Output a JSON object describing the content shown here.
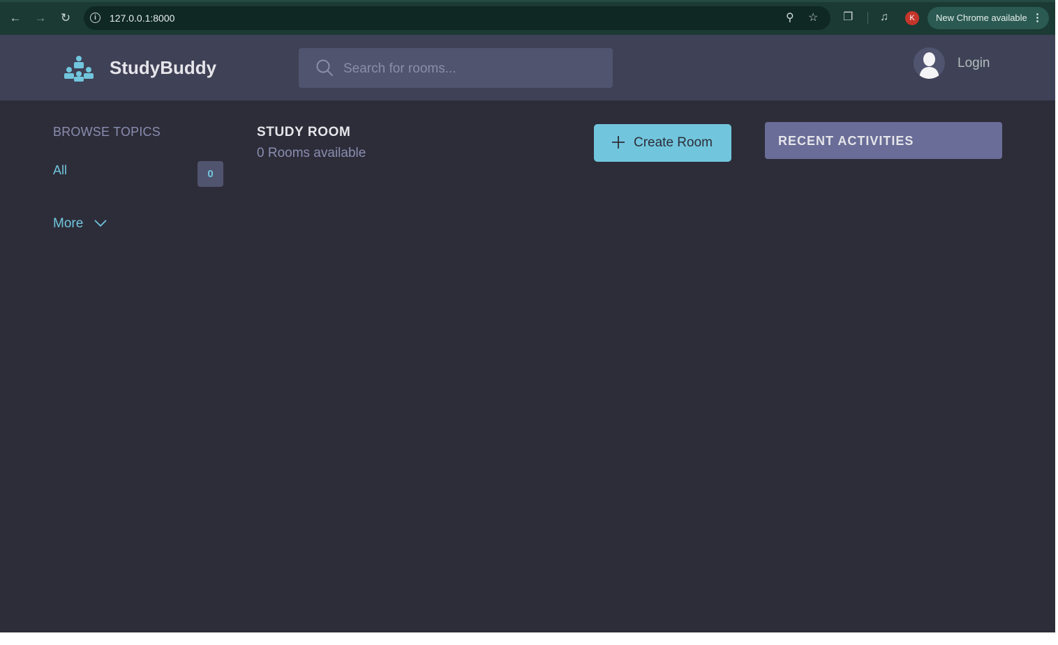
{
  "browser": {
    "url": "127.0.0.1:8000",
    "profile_initial": "K",
    "update_label": "New Chrome available"
  },
  "header": {
    "brand": "StudyBuddy",
    "search_placeholder": "Search for rooms...",
    "login_label": "Login"
  },
  "sidebar": {
    "title": "BROWSE TOPICS",
    "topics": [
      {
        "label": "All",
        "count": "0"
      }
    ],
    "more_label": "More"
  },
  "main": {
    "title": "STUDY ROOM",
    "rooms_available": "0 Rooms available",
    "create_label": "Create Room"
  },
  "activities": {
    "title": "RECENT ACTIVITIES"
  },
  "colors": {
    "accent": "#71c6dd",
    "background": "#2d2d39",
    "header": "#3f4156",
    "activities": "#696d97"
  }
}
